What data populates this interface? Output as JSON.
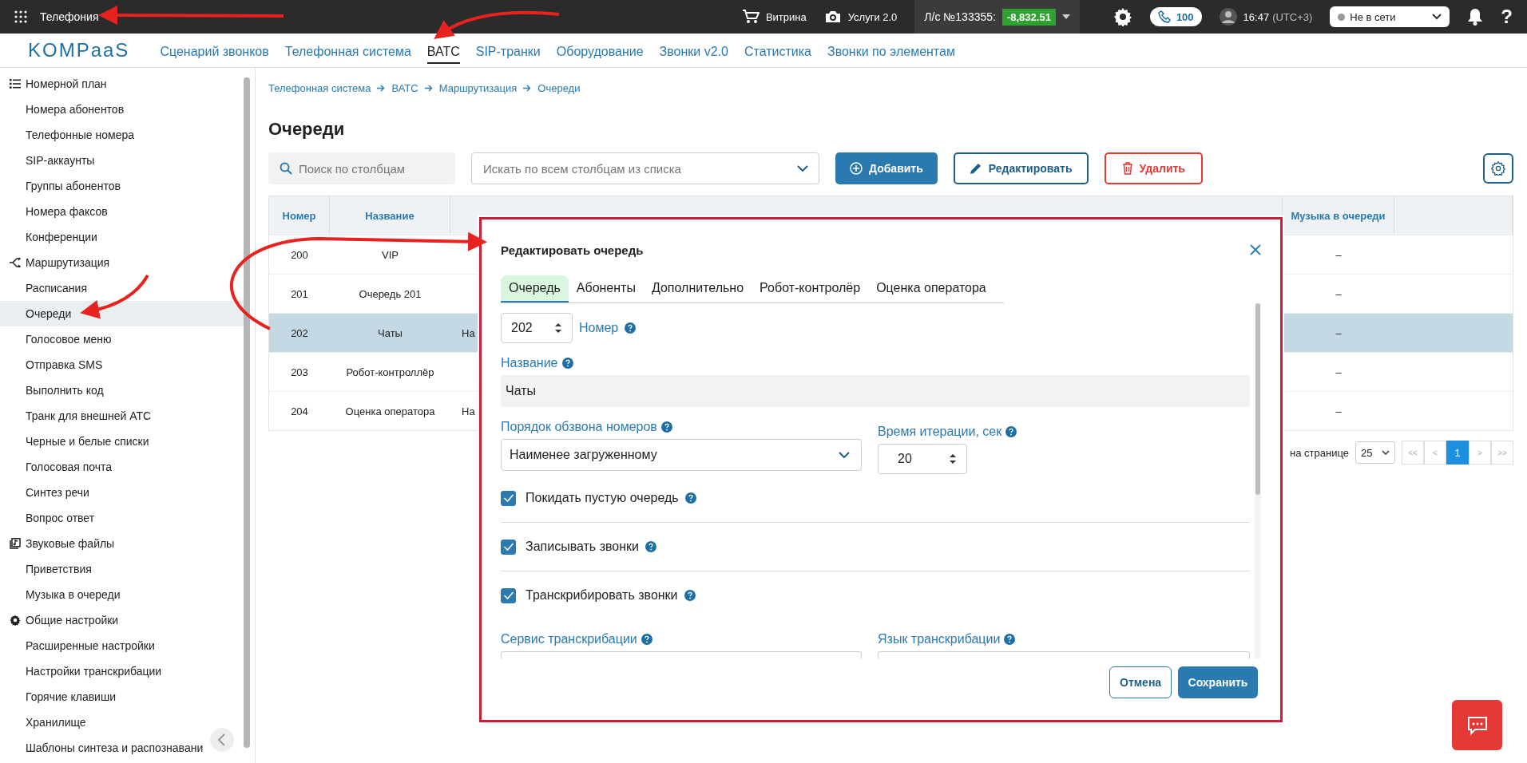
{
  "topbar": {
    "app_title": "Телефония",
    "showcase": "Витрина",
    "services": "Услуги 2.0",
    "account_label": "Л/с №133355:",
    "balance": "-8,832.51",
    "calls_count": "100",
    "time": "16:47",
    "timezone": "(UTC+3)",
    "status": "Не в сети",
    "help": "?"
  },
  "nav": {
    "logo": "KOMPaaS",
    "items": [
      {
        "label": "Сценарий звонков",
        "selected": false
      },
      {
        "label": "Телефонная система",
        "selected": false
      },
      {
        "label": "ВАТС",
        "selected": true
      },
      {
        "label": "SIP-транки",
        "selected": false
      },
      {
        "label": "Оборудование",
        "selected": false
      },
      {
        "label": "Звонки v2.0",
        "selected": false
      },
      {
        "label": "Статистика",
        "selected": false
      },
      {
        "label": "Звонки по элементам",
        "selected": false
      }
    ]
  },
  "sidebar": {
    "groups": [
      {
        "kind": "list",
        "label": "Номерной план",
        "items": [
          {
            "label": "Номера абонентов",
            "selected": false
          },
          {
            "label": "Телефонные номера",
            "selected": false
          },
          {
            "label": "SIP-аккаунты",
            "selected": false
          },
          {
            "label": "Группы абонентов",
            "selected": false
          },
          {
            "label": "Номера факсов",
            "selected": false
          },
          {
            "label": "Конференции",
            "selected": false
          }
        ]
      },
      {
        "kind": "routing",
        "label": "Маршрутизация",
        "items": [
          {
            "label": "Расписания",
            "selected": false
          },
          {
            "label": "Очереди",
            "selected": true
          },
          {
            "label": "Голосовое меню",
            "selected": false
          },
          {
            "label": "Отправка SMS",
            "selected": false
          },
          {
            "label": "Выполнить код",
            "selected": false
          },
          {
            "label": "Транк для внешней АТС",
            "selected": false
          },
          {
            "label": "Черные и белые списки",
            "selected": false
          },
          {
            "label": "Голосовая почта",
            "selected": false
          },
          {
            "label": "Синтез речи",
            "selected": false
          },
          {
            "label": "Вопрос ответ",
            "selected": false
          }
        ]
      },
      {
        "kind": "sound",
        "label": "Звуковые файлы",
        "items": [
          {
            "label": "Приветствия",
            "selected": false
          },
          {
            "label": "Музыка в очереди",
            "selected": false
          }
        ]
      },
      {
        "kind": "settings",
        "label": "Общие настройки",
        "items": [
          {
            "label": "Расширенные настройки",
            "selected": false
          },
          {
            "label": "Настройки транскрибации",
            "selected": false
          },
          {
            "label": "Горячие клавиши",
            "selected": false
          },
          {
            "label": "Хранилище",
            "selected": false
          },
          {
            "label": "Шаблоны синтеза и распознавани",
            "selected": false
          }
        ]
      }
    ]
  },
  "breadcrumb": [
    "Телефонная система",
    "ВАТС",
    "Маршрутизация",
    "Очереди"
  ],
  "page_title": "Очереди",
  "toolbar": {
    "search_placeholder": "Поиск по столбцам",
    "filter_placeholder": "Искать по всем столбцам из списка",
    "buttons": [
      {
        "kind": "add",
        "label": "Добавить"
      },
      {
        "kind": "edit",
        "label": "Редактировать"
      },
      {
        "kind": "delete",
        "label": "Удалить"
      }
    ]
  },
  "table": {
    "columns": [
      "Номер",
      "Название",
      "Музыка в очереди"
    ],
    "rows": [
      {
        "number": "200",
        "name": "VIP",
        "music": "–",
        "selected": false
      },
      {
        "number": "201",
        "name": "Очередь 201",
        "music": "–",
        "selected": false
      },
      {
        "number": "202",
        "name": "Чаты",
        "column_3": "На",
        "music": "–",
        "selected": true
      },
      {
        "number": "203",
        "name": "Робот-контроллёр",
        "music": "–",
        "selected": false
      },
      {
        "number": "204",
        "name": "Оценка оператора",
        "column_3": "На",
        "music": "–",
        "selected": false
      }
    ]
  },
  "pagination": {
    "per_page_label": "на странице",
    "per_page": "25",
    "first": "<<",
    "prev": "<",
    "pages": [
      {
        "label": "1",
        "selected": true
      }
    ],
    "next": ">",
    "last": ">>"
  },
  "modal": {
    "title": "Редактировать очередь",
    "tabs": [
      {
        "label": "Очередь",
        "selected": true
      },
      {
        "label": "Абоненты",
        "selected": false
      },
      {
        "label": "Дополнительно",
        "selected": false
      },
      {
        "label": "Робот-контролёр",
        "selected": false
      },
      {
        "label": "Оценка оператора",
        "selected": false
      }
    ],
    "number": {
      "label": "Номер",
      "value": "202"
    },
    "name": {
      "label": "Название",
      "value": "Чаты"
    },
    "dial_order": {
      "label": "Порядок обзвона номеров",
      "value": "Наименее загруженному"
    },
    "iteration": {
      "label": "Время итерации, сек",
      "value": "20"
    },
    "checkboxes": [
      {
        "label": "Покидать пустую очередь",
        "checked": true
      },
      {
        "label": "Записывать звонки",
        "checked": true
      },
      {
        "label": "Транскрибировать звонки",
        "checked": true
      }
    ],
    "service": {
      "label": "Сервис транскрибации"
    },
    "language": {
      "label": "Язык транскрибации"
    },
    "buttons": [
      {
        "kind": "cancel",
        "label": "Отмена"
      },
      {
        "kind": "save",
        "label": "Сохранить"
      }
    ]
  }
}
